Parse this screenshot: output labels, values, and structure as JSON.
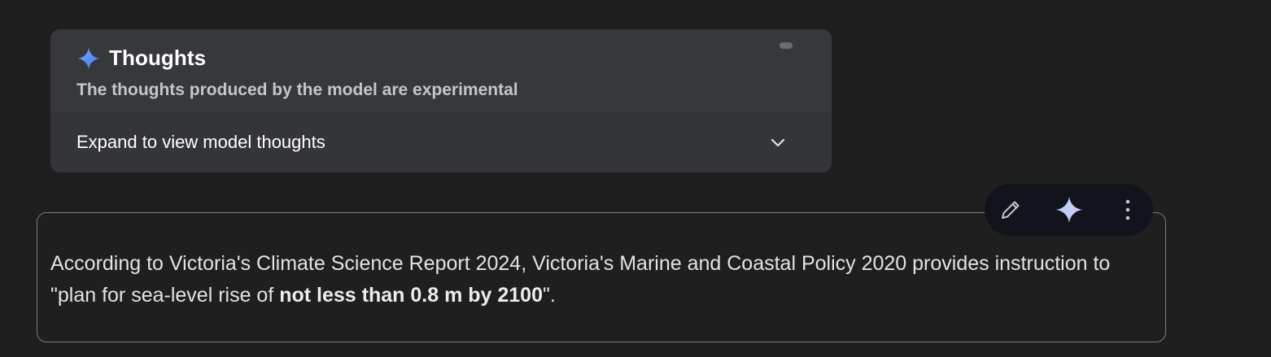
{
  "thoughts": {
    "title": "Thoughts",
    "subtitle": "The thoughts produced by the model are experimental",
    "expand_label": "Expand to view model thoughts",
    "icon": "sparkle-icon",
    "chevron": "chevron-down-icon"
  },
  "response": {
    "text_before": "According to Victoria's Climate Science Report 2024, Victoria's Marine and Coastal Policy 2020 provides instruction to \"plan for sea-level rise of ",
    "text_bold": "not less than 0.8 m by 2100",
    "text_after": "\"."
  },
  "toolbar": {
    "icons": [
      "pencil-icon",
      "sparkle-icon",
      "more-vert-icon"
    ]
  },
  "colors": {
    "background": "#1f1f1f",
    "panel": "#333538",
    "sparkle_blue": "#4f8df5",
    "toolbar_bg": "#11141c",
    "toolbar_sparkle": "#c3cbf7"
  }
}
